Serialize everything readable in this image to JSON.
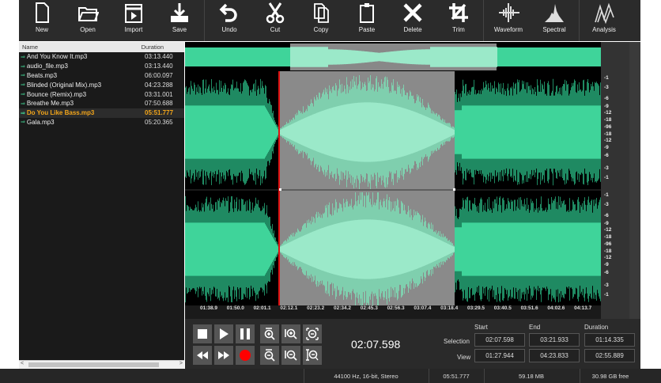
{
  "toolbar": [
    {
      "label": "New",
      "icon": "new-file-icon"
    },
    {
      "label": "Open",
      "icon": "folder-open-icon"
    },
    {
      "label": "Import",
      "icon": "import-icon"
    },
    {
      "label": "Save",
      "icon": "save-icon"
    },
    {
      "label": "Undo",
      "icon": "undo-icon"
    },
    {
      "label": "Cut",
      "icon": "scissors-icon"
    },
    {
      "label": "Copy",
      "icon": "copy-icon"
    },
    {
      "label": "Paste",
      "icon": "paste-icon"
    },
    {
      "label": "Delete",
      "icon": "delete-icon"
    },
    {
      "label": "Trim",
      "icon": "crop-icon"
    },
    {
      "label": "Waveform",
      "icon": "waveform-icon"
    },
    {
      "label": "Spectral",
      "icon": "spectral-icon"
    },
    {
      "label": "Analysis",
      "icon": "analysis-icon"
    }
  ],
  "file_list": {
    "headers": {
      "name": "Name",
      "duration": "Duration"
    },
    "files": [
      {
        "name": "And You Know It.mp3",
        "duration": "03:13.440"
      },
      {
        "name": "audio_file.mp3",
        "duration": "03:13.440"
      },
      {
        "name": "Beats.mp3",
        "duration": "06:00.097"
      },
      {
        "name": "Blinded (Original Mix).mp3",
        "duration": "04:23.288"
      },
      {
        "name": "Bounce (Remix).mp3",
        "duration": "03:31.001"
      },
      {
        "name": "Breathe Me.mp3",
        "duration": "07:50.688"
      },
      {
        "name": "Do You Like Bass.mp3",
        "duration": "05:51.777",
        "selected": true
      },
      {
        "name": "Gala.mp3",
        "duration": "05:20.365"
      }
    ]
  },
  "timeline": [
    "01:38.9",
    "01:50.0",
    "02:01.1",
    "02:12.1",
    "02:23.2",
    "02:34.2",
    "02:45.3",
    "02:56.3",
    "03:07.4",
    "03:18.4",
    "03:29.5",
    "03:40.5",
    "03:51.6",
    "04:02.6",
    "04:13.7"
  ],
  "db_scale": [
    "-1",
    "-3",
    "-6",
    "-9",
    "-12",
    "-18",
    "-96",
    "-18",
    "-12",
    "-9",
    "-6",
    "-3",
    "-1"
  ],
  "current_time": "02:07.598",
  "selection": {
    "labels": {
      "start": "Start",
      "end": "End",
      "duration": "Duration",
      "selection": "Selection",
      "view": "View"
    },
    "selection": {
      "start": "02:07.598",
      "end": "03:21.933",
      "duration": "01:14.335"
    },
    "view": {
      "start": "01:27.944",
      "end": "04:23.833",
      "duration": "02:55.889"
    }
  },
  "status": {
    "format": "44100 Hz, 16-bit, Stereo",
    "length": "05:51.777",
    "size": "59.18 MB",
    "free": "30.98 GB free"
  },
  "colors": {
    "wave": "#3fd49a",
    "wave_sel": "#9be9c9",
    "selection_bg": "#8a8a8a",
    "cursor": "#e01010",
    "accent": "#f2a51a"
  }
}
